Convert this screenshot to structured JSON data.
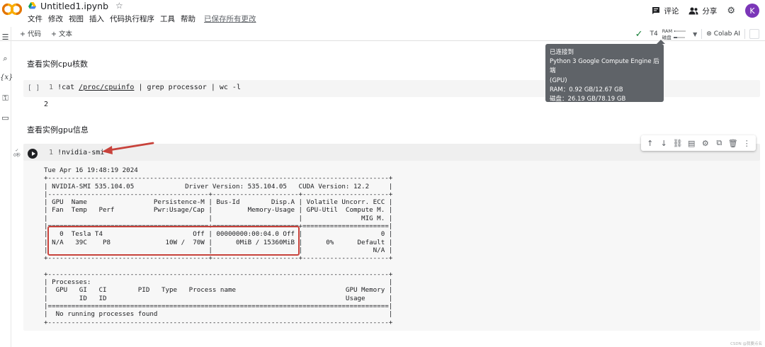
{
  "header": {
    "logo_text": "CO",
    "doc_title": "Untitled1.ipynb",
    "menu": [
      "文件",
      "修改",
      "视图",
      "插入",
      "代码执行程序",
      "工具",
      "帮助"
    ],
    "saved_status": "已保存所有更改",
    "comment_label": "评论",
    "share_label": "分享",
    "avatar_letter": "K"
  },
  "toolbar": {
    "add_code": "+ 代码",
    "add_text": "+ 文本",
    "runtime_type": "T4",
    "ram_label": "RAM",
    "disk_label": "磁盘",
    "ram_fraction": 0.07,
    "disk_fraction": 0.33,
    "colab_ai": "Colab AI"
  },
  "tooltip": {
    "line1": "已连接到",
    "line2": "Python 3 Google Compute Engine 后端",
    "line3": "(GPU)",
    "line4": "RAM：0.92 GB/12.67 GB",
    "line5": "磁盘：26.19 GB/78.19 GB"
  },
  "cells": {
    "text1": "查看实例cpu核数",
    "cell1_bracket": "[ ]",
    "cell1_ln": "1",
    "cell1_cmd": "!cat ",
    "cell1_path": "/proc/cpuinfo",
    "cell1_rest": " | grep processor | wc -l",
    "cell1_output": "2",
    "text2": "查看实例gpu信息",
    "cell2_ln": "1",
    "cell2_cmd": "!nvidia-smi",
    "cell2_exec": "✓\n0秒",
    "cell2_output": "Tue Apr 16 19:48:19 2024\n+---------------------------------------------------------------------------------------+\n| NVIDIA-SMI 535.104.05             Driver Version: 535.104.05   CUDA Version: 12.2     |\n|-----------------------------------------+----------------------+----------------------+\n| GPU  Name                 Persistence-M | Bus-Id        Disp.A | Volatile Uncorr. ECC |\n| Fan  Temp   Perf          Pwr:Usage/Cap |         Memory-Usage | GPU-Util  Compute M. |\n|                                         |                      |               MIG M. |\n|=========================================+======================+======================|\n|   0  Tesla T4                       Off | 00000000:00:04.0 Off |                    0 |\n| N/A   39C    P8              10W /  70W |      0MiB / 15360MiB |      0%      Default |\n|                                         |                      |                  N/A |\n+-----------------------------------------+----------------------+----------------------+\n                                                                                         \n+---------------------------------------------------------------------------------------+\n| Processes:                                                                            |\n|  GPU   GI   CI        PID   Type   Process name                            GPU Memory |\n|        ID   ID                                                             Usage      |\n|=======================================================================================|\n|  No running processes found                                                           |\n+---------------------------------------------------------------------------------------+"
  },
  "watermark": "CSDN @我要点名",
  "colors": {
    "accent_check": "#188038",
    "avatar": "#7b36b8",
    "highlight": "#c8423b",
    "cell_bg": "#f5f5f5",
    "tooltip_bg": "#5f6368"
  }
}
